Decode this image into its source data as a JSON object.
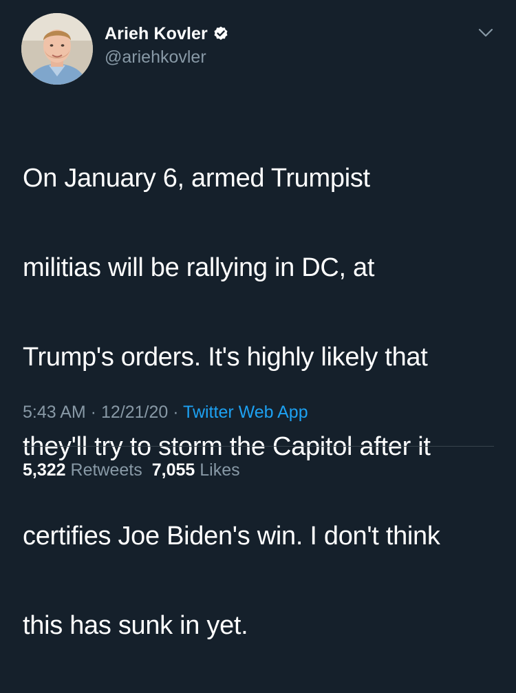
{
  "author": {
    "display_name": "Arieh Kovler",
    "handle": "@ariehkovler",
    "verified": true,
    "avatar_icon": "profile-photo"
  },
  "tweet": {
    "lines": [
      "On January 6, armed Trumpist",
      "militias will be rallying in DC, at",
      "Trump's orders. It's highly likely that",
      "they'll try to storm the Capitol after it",
      "certifies Joe Biden's win. I don't think",
      "this has sunk in yet."
    ]
  },
  "meta": {
    "time": "5:43 AM",
    "separator": " · ",
    "date": "12/21/20",
    "source": "Twitter Web App"
  },
  "stats": {
    "retweets_count": "5,322",
    "retweets_label": "Retweets",
    "likes_count": "7,055",
    "likes_label": "Likes"
  },
  "colors": {
    "background": "#15202b",
    "secondary_text": "#8899a6",
    "accent": "#1da1f2",
    "divider": "#38444d"
  },
  "icons": {
    "verified": "verified-badge-icon",
    "menu": "chevron-down-icon"
  }
}
